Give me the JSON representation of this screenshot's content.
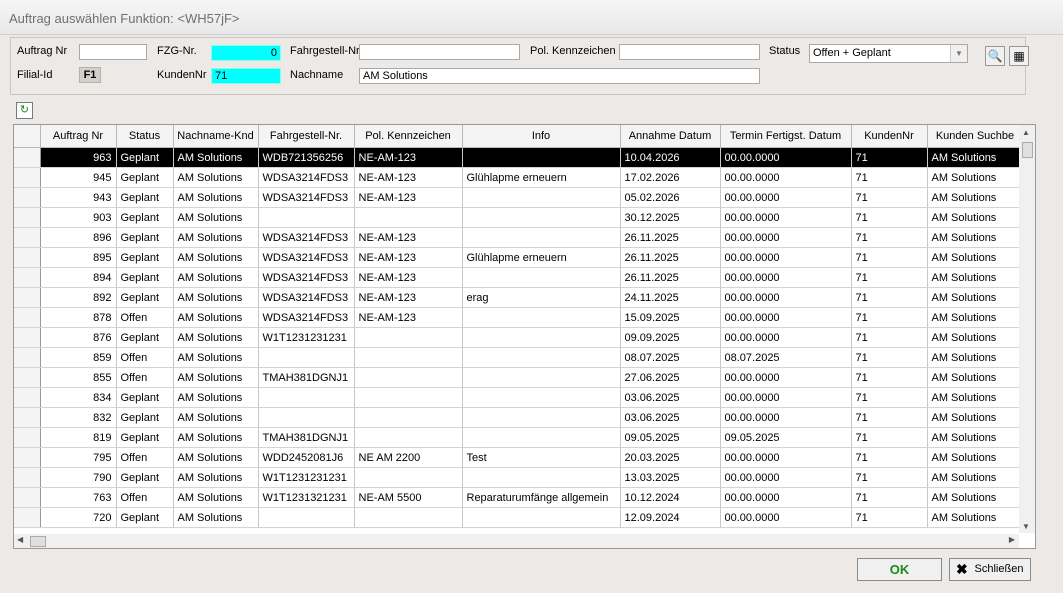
{
  "window": {
    "title": "Auftrag auswählen   Funktion: <WH57jF>"
  },
  "filter": {
    "auftrag_nr_label": "Auftrag Nr",
    "auftrag_nr_value": "",
    "filial_id_label": "Filial-Id",
    "filial_id_value": "F1",
    "fzg_nr_label": "FZG-Nr.",
    "fzg_nr_value": "0",
    "kunden_nr_label": "KundenNr",
    "kunden_nr_value": "71",
    "fahrgestell_label": "Fahrgestell-Nr.",
    "fahrgestell_value": "",
    "nachname_label": "Nachname",
    "nachname_value": "AM Solutions",
    "kennzeichen_label": "Pol. Kennzeichen",
    "kennzeichen_value": "",
    "status_label": "Status",
    "status_value": "Offen + Geplant"
  },
  "grid": {
    "columns": [
      "Auftrag Nr",
      "Status",
      "Nachname-Knd",
      "Fahrgestell-Nr.",
      "Pol. Kennzeichen",
      "Info",
      "Annahme Datum",
      "Termin Fertigst. Datum",
      "KundenNr",
      "Kunden Suchbe"
    ],
    "rows": [
      [
        "963",
        "Geplant",
        "AM Solutions",
        "WDB721356256",
        "NE-AM-123",
        "",
        "10.04.2026",
        "00.00.0000",
        "71",
        "AM Solutions"
      ],
      [
        "945",
        "Geplant",
        "AM Solutions",
        "WDSA3214FDS3",
        "NE-AM-123",
        "Glühlapme erneuern",
        "17.02.2026",
        "00.00.0000",
        "71",
        "AM Solutions"
      ],
      [
        "943",
        "Geplant",
        "AM Solutions",
        "WDSA3214FDS3",
        "NE-AM-123",
        "",
        "05.02.2026",
        "00.00.0000",
        "71",
        "AM Solutions"
      ],
      [
        "903",
        "Geplant",
        "AM Solutions",
        "",
        "",
        "",
        "30.12.2025",
        "00.00.0000",
        "71",
        "AM Solutions"
      ],
      [
        "896",
        "Geplant",
        "AM Solutions",
        "WDSA3214FDS3",
        "NE-AM-123",
        "",
        "26.11.2025",
        "00.00.0000",
        "71",
        "AM Solutions"
      ],
      [
        "895",
        "Geplant",
        "AM Solutions",
        "WDSA3214FDS3",
        "NE-AM-123",
        "Glühlapme erneuern",
        "26.11.2025",
        "00.00.0000",
        "71",
        "AM Solutions"
      ],
      [
        "894",
        "Geplant",
        "AM Solutions",
        "WDSA3214FDS3",
        "NE-AM-123",
        "",
        "26.11.2025",
        "00.00.0000",
        "71",
        "AM Solutions"
      ],
      [
        "892",
        "Geplant",
        "AM Solutions",
        "WDSA3214FDS3",
        "NE-AM-123",
        "erag",
        "24.11.2025",
        "00.00.0000",
        "71",
        "AM Solutions"
      ],
      [
        "878",
        "Offen",
        "AM Solutions",
        "WDSA3214FDS3",
        "NE-AM-123",
        "",
        "15.09.2025",
        "00.00.0000",
        "71",
        "AM Solutions"
      ],
      [
        "876",
        "Geplant",
        "AM Solutions",
        "W1T1231231231",
        "",
        "",
        "09.09.2025",
        "00.00.0000",
        "71",
        "AM Solutions"
      ],
      [
        "859",
        "Offen",
        "AM Solutions",
        "",
        "",
        "",
        "08.07.2025",
        "08.07.2025",
        "71",
        "AM Solutions"
      ],
      [
        "855",
        "Offen",
        "AM Solutions",
        "TMAH381DGNJ1",
        "",
        "",
        "27.06.2025",
        "00.00.0000",
        "71",
        "AM Solutions"
      ],
      [
        "834",
        "Geplant",
        "AM Solutions",
        "",
        "",
        "",
        "03.06.2025",
        "00.00.0000",
        "71",
        "AM Solutions"
      ],
      [
        "832",
        "Geplant",
        "AM Solutions",
        "",
        "",
        "",
        "03.06.2025",
        "00.00.0000",
        "71",
        "AM Solutions"
      ],
      [
        "819",
        "Geplant",
        "AM Solutions",
        "TMAH381DGNJ1",
        "",
        "",
        "09.05.2025",
        "09.05.2025",
        "71",
        "AM Solutions"
      ],
      [
        "795",
        "Offen",
        "AM Solutions",
        "WDD2452081J6",
        "NE AM 2200",
        "Test",
        "20.03.2025",
        "00.00.0000",
        "71",
        "AM Solutions"
      ],
      [
        "790",
        "Geplant",
        "AM Solutions",
        "W1T1231231231",
        "",
        "",
        "13.03.2025",
        "00.00.0000",
        "71",
        "AM Solutions"
      ],
      [
        "763",
        "Offen",
        "AM Solutions",
        "W1T1231321231",
        "NE-AM 5500",
        "Reparaturumfänge allgemein",
        "10.12.2024",
        "00.00.0000",
        "71",
        "AM Solutions"
      ],
      [
        "720",
        "Geplant",
        "AM Solutions",
        "",
        "",
        "",
        "12.09.2024",
        "00.00.0000",
        "71",
        "AM Solutions"
      ]
    ]
  },
  "buttons": {
    "ok_label": "OK",
    "close_label": "Schließen"
  }
}
